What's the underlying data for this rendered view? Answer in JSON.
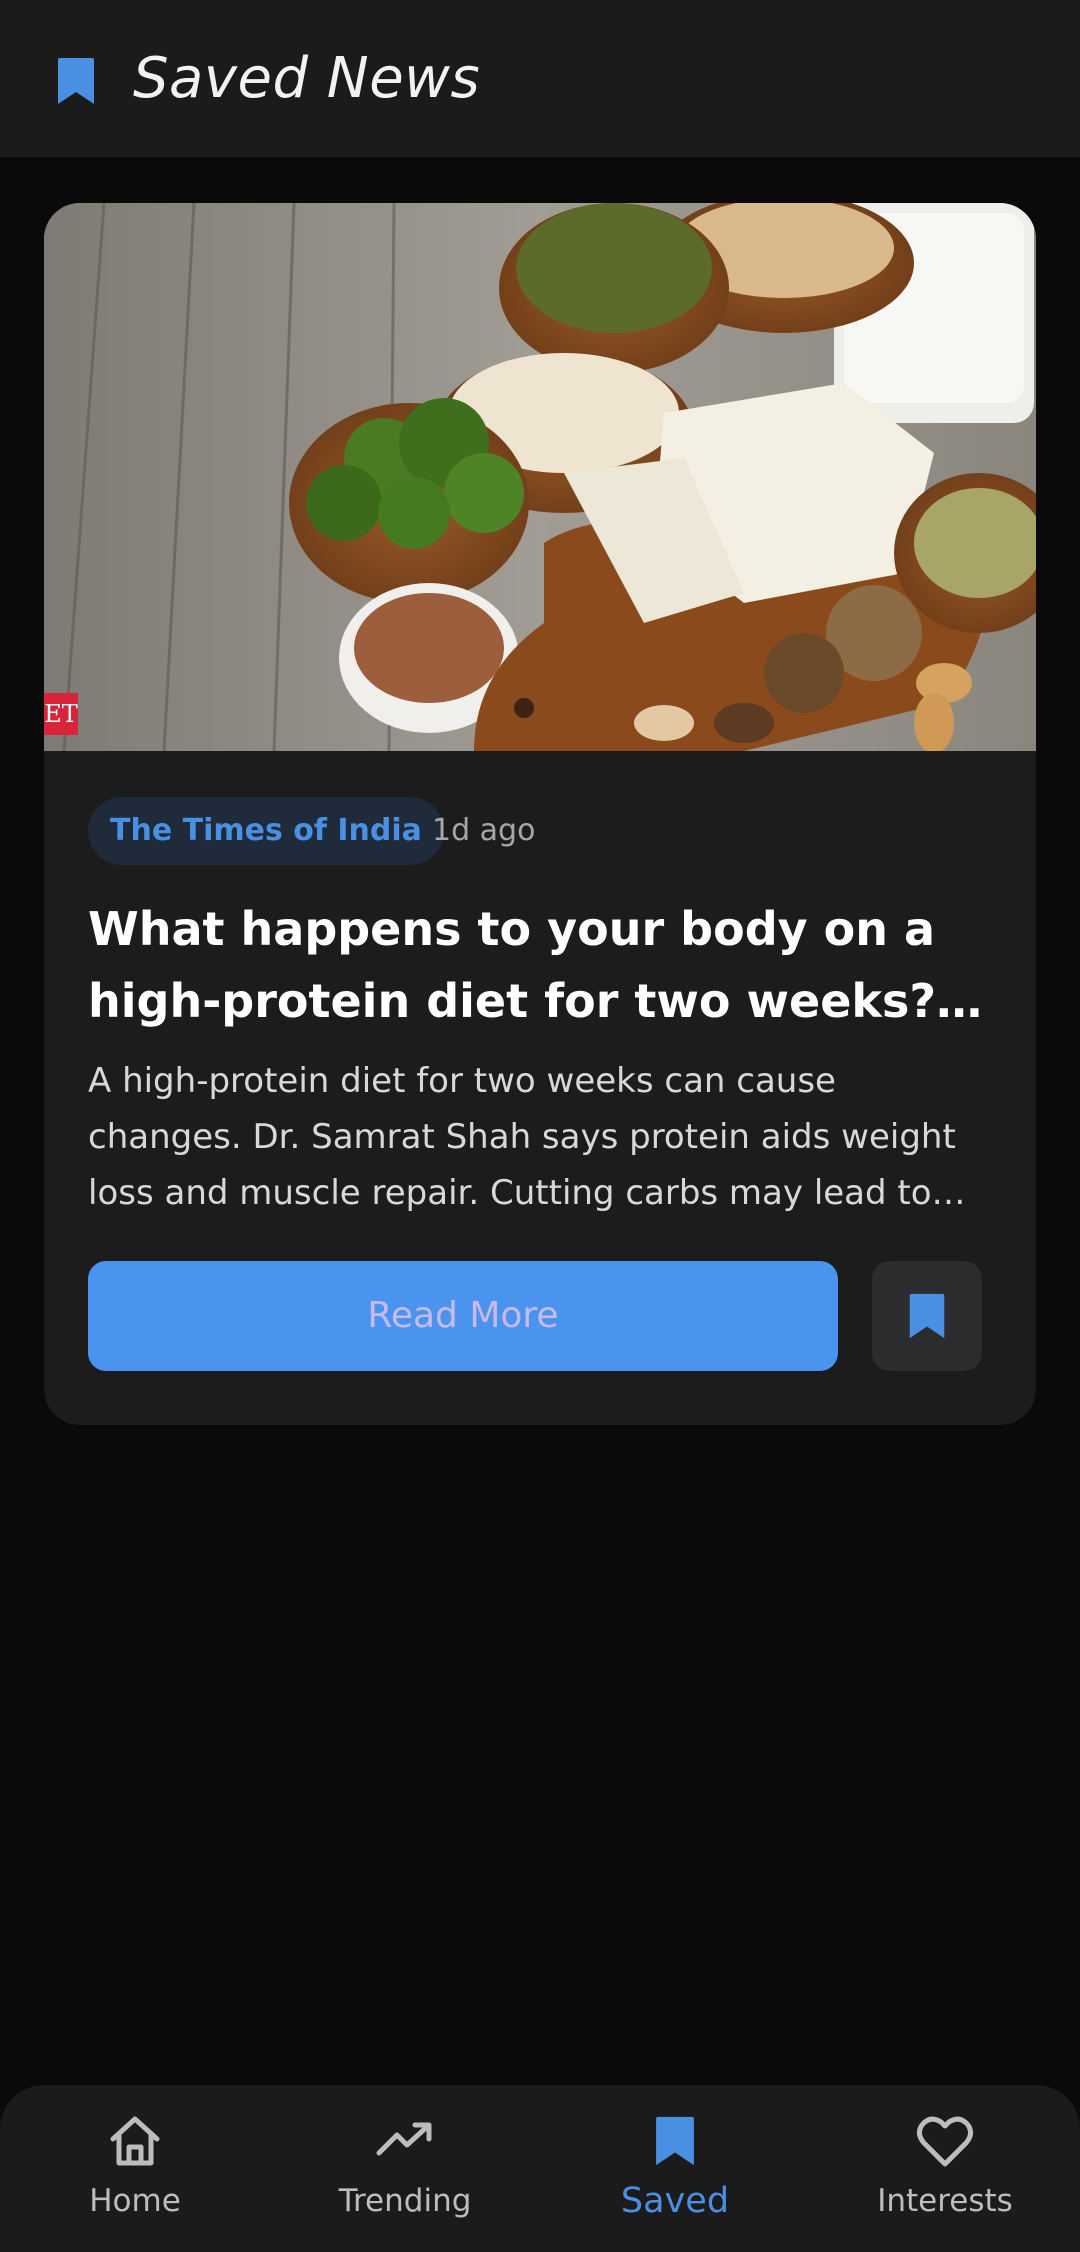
{
  "header": {
    "title": "Saved News",
    "icon": "bookmark-icon",
    "accent": "#4a90e2"
  },
  "article": {
    "source": "The Times of India",
    "time_ago": "1d ago",
    "image_badge": "ET",
    "headline": "What happens to your body on a high-protein diet for two weeks? Experts weigh in",
    "summary": "A high-protein diet for two weeks can cause changes. Dr. Samrat Shah says protein aids weight loss and muscle repair. Cutting carbs may lead to fatigue",
    "read_more_label": "Read More",
    "save_icon": "bookmark-filled-icon"
  },
  "nav": {
    "items": [
      {
        "label": "Home",
        "icon": "home-icon",
        "active": false
      },
      {
        "label": "Trending",
        "icon": "trending-up-icon",
        "active": false
      },
      {
        "label": "Saved",
        "icon": "bookmark-icon",
        "active": true
      },
      {
        "label": "Interests",
        "icon": "heart-icon",
        "active": false
      }
    ]
  }
}
